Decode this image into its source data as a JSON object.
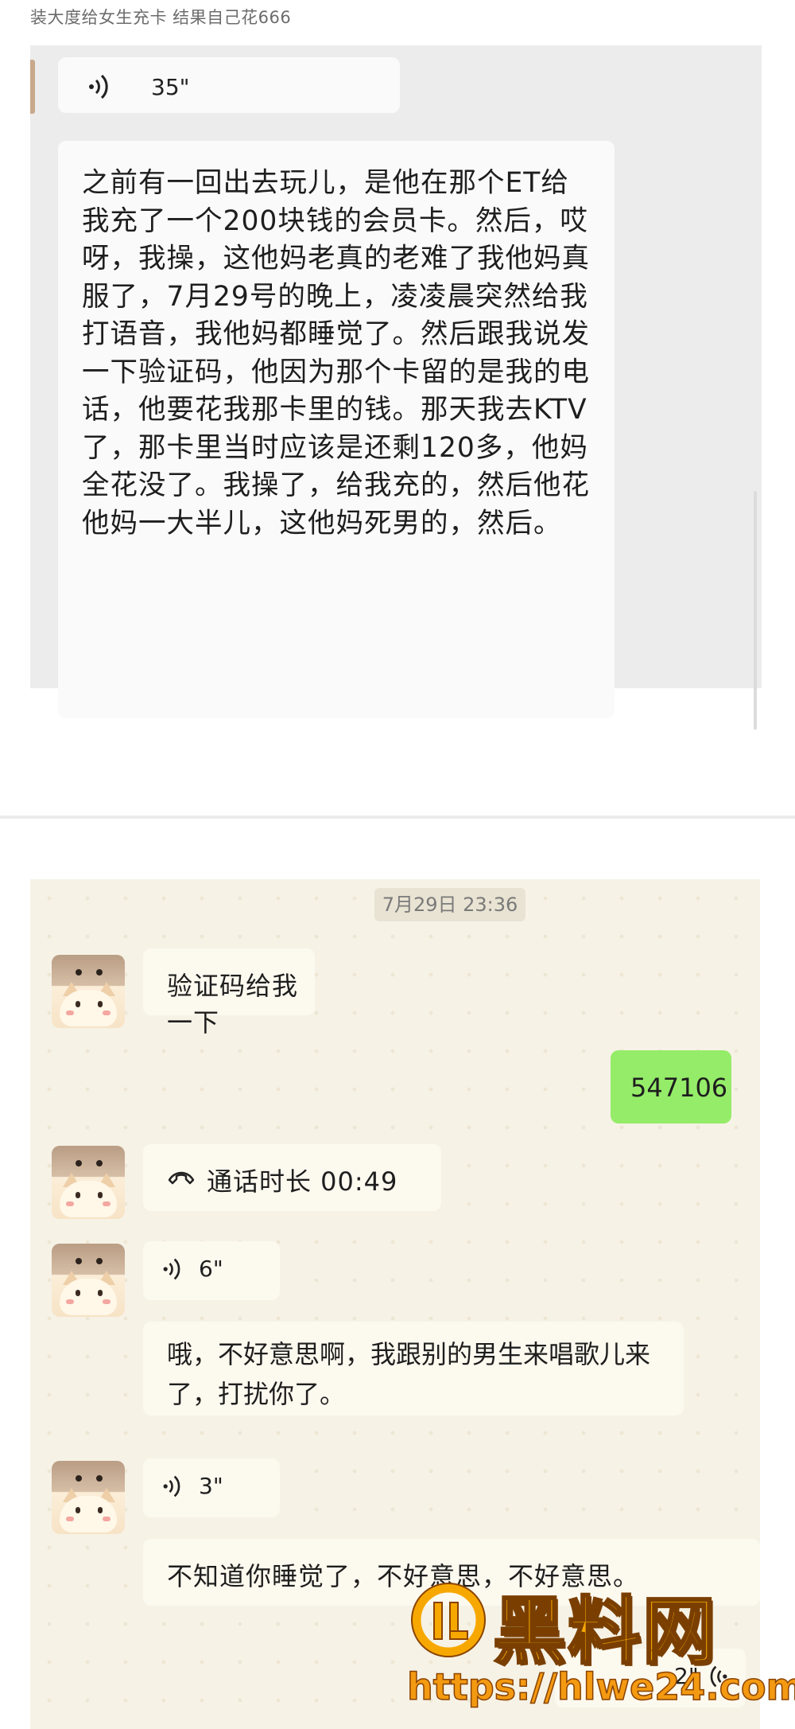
{
  "caption": "装大度给女生充卡 结果自己花666",
  "top_chat": {
    "voice_duration": "35\"",
    "transcript": "之前有一回出去玩儿，是他在那个ET给我充了一个200块钱的会员卡。然后，哎呀，我操，这他妈老真的老难了我他妈真服了，7月29号的晚上，凌凌晨突然给我打语音，我他妈都睡觉了。然后跟我说发一下验证码，他因为那个卡留的是我的电话，他要花我那卡里的钱。那天我去KTV了，那卡里当时应该是还剩120多，他妈全花没了。我操了，给我充的，然后他花他妈一大半儿，这他妈死男的，然后。"
  },
  "bottom_chat": {
    "timestamp": "7月29日 23:36",
    "msg_verify": "验证码给我一下",
    "msg_code": "547106",
    "call_label": "通话时长 00:49",
    "voice_6": "6\"",
    "transcript_6": "哦，不好意思啊，我跟别的男生来唱歌儿来了，打扰你了。",
    "voice_3": "3\"",
    "transcript_3": "不知道你睡觉了，不好意思，不好意思。",
    "voice_2": "2\""
  },
  "watermark": {
    "title": "黑料网",
    "url": "https://hlwe24.com"
  },
  "colors": {
    "sent_bubble": "#95ec69",
    "chat_bg": "#f6f2e6",
    "watermark": "#f7a800"
  }
}
